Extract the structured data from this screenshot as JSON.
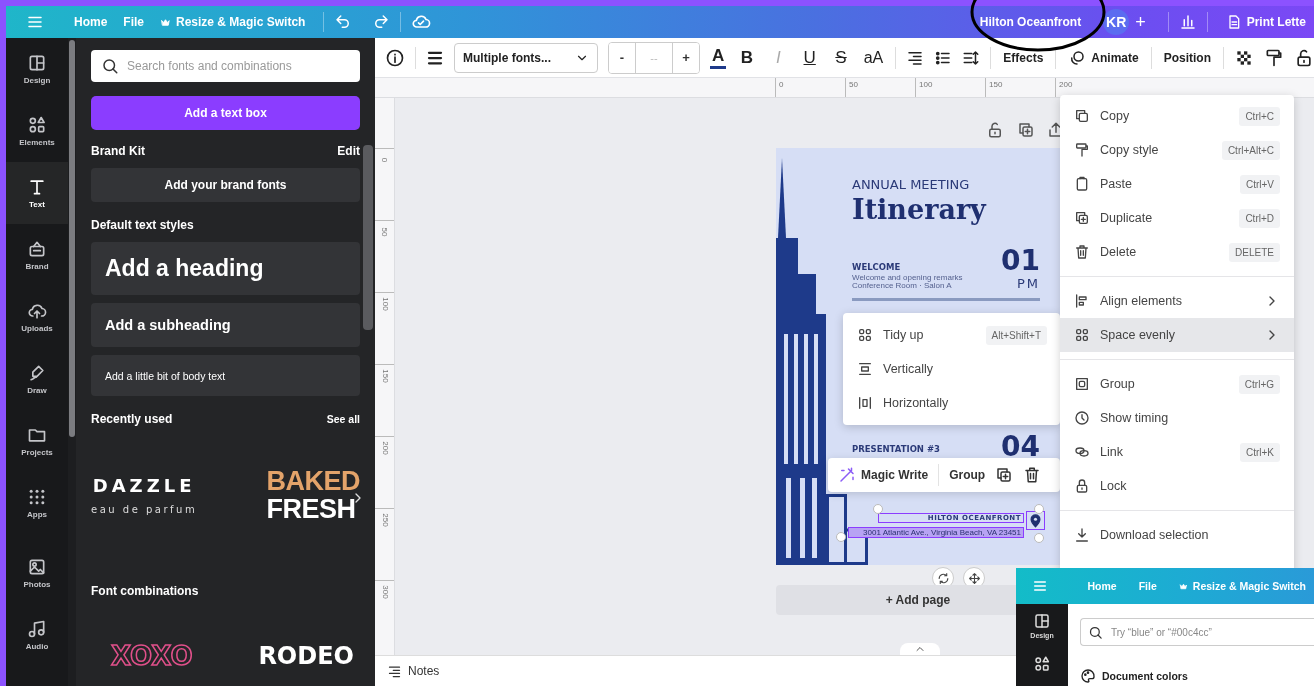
{
  "top_bar": {
    "nav": [
      {
        "label": "Home"
      },
      {
        "label": "File"
      }
    ],
    "resize": "Resize & Magic Switch",
    "title": "Hilton Oceanfront",
    "avatar": "KR",
    "add": "+",
    "print": "Print Lette"
  },
  "rail": [
    {
      "label": "Design",
      "selected": false
    },
    {
      "label": "Elements",
      "selected": false
    },
    {
      "label": "Text",
      "selected": true
    },
    {
      "label": "Brand",
      "selected": false
    },
    {
      "label": "Uploads",
      "selected": false
    },
    {
      "label": "Draw",
      "selected": false
    },
    {
      "label": "Projects",
      "selected": false
    },
    {
      "label": "Apps",
      "selected": false
    },
    {
      "label": "Photos",
      "selected": false
    },
    {
      "label": "Audio",
      "selected": false
    }
  ],
  "panel": {
    "search_placeholder": "Search fonts and combinations",
    "add_text_box": "Add a text box",
    "brand_kit": {
      "title": "Brand Kit",
      "edit": "Edit",
      "add_fonts": "Add your brand fonts"
    },
    "default_styles": {
      "title": "Default text styles",
      "heading": "Add a heading",
      "subheading": "Add a subheading",
      "body": "Add a little bit of body text"
    },
    "recently_used": {
      "title": "Recently used",
      "see_all": "See all",
      "fonts": [
        {
          "kind": "spaced",
          "lines": [
            "DAZZLE",
            "eau de parfum"
          ]
        },
        {
          "kind": "stacked",
          "lines": [
            "BAKED",
            "FRESH"
          ]
        }
      ]
    },
    "combinations": {
      "title": "Font combinations",
      "fonts": [
        {
          "kind": "outline",
          "label": "XOXO"
        },
        {
          "kind": "solid",
          "label": "RODEO"
        }
      ]
    }
  },
  "toolbar": {
    "font": "Multiple fonts...",
    "minus": "-",
    "size": "--",
    "plus": "+",
    "color_letter": "A",
    "styles": [
      {
        "label": "B",
        "kind": "bold"
      },
      {
        "label": "I",
        "kind": "italic"
      },
      {
        "label": "U",
        "kind": "underline"
      },
      {
        "label": "S",
        "kind": "strike"
      },
      {
        "label": "aA",
        "kind": "case"
      }
    ],
    "effects": "Effects",
    "animate": "Animate",
    "position": "Position"
  },
  "rulers": {
    "horizontal": [
      "0",
      "50",
      "100",
      "150",
      "200"
    ],
    "vertical": [
      "0",
      "50",
      "100",
      "150",
      "200",
      "250",
      "300"
    ]
  },
  "design": {
    "overline": "ANNUAL MEETING",
    "title": "Itinerary",
    "sessions": [
      {
        "title": "WELCOME",
        "details": [
          "Welcome and opening remarks",
          "Conference Room · Salon A"
        ],
        "number": "01",
        "time": "PM"
      },
      {
        "title": "PRESENTATION #3",
        "number": "04"
      }
    ],
    "venue": "HILTON OCEANFRONT",
    "address": "3001 Atlantic Ave., Virginia Beach, VA 23451"
  },
  "selection_toolbar": {
    "magic": "Magic Write",
    "group": "Group"
  },
  "space_menu": [
    {
      "label": "Tidy up",
      "shortcut": "Alt+Shift+T"
    },
    {
      "label": "Vertically"
    },
    {
      "label": "Horizontally"
    }
  ],
  "context_menu": [
    [
      {
        "label": "Copy",
        "shortcut": "Ctrl+C",
        "selected": false,
        "has_submenu": false
      },
      {
        "label": "Copy style",
        "shortcut": "Ctrl+Alt+C",
        "selected": false,
        "has_submenu": false
      },
      {
        "label": "Paste",
        "shortcut": "Ctrl+V",
        "selected": false,
        "has_submenu": false
      },
      {
        "label": "Duplicate",
        "shortcut": "Ctrl+D",
        "selected": false,
        "has_submenu": false
      },
      {
        "label": "Delete",
        "shortcut": "DELETE",
        "selected": false,
        "has_submenu": false
      }
    ],
    [
      {
        "label": "Align elements",
        "selected": false,
        "has_submenu": true
      },
      {
        "label": "Space evenly",
        "selected": true,
        "has_submenu": true
      }
    ],
    [
      {
        "label": "Group",
        "shortcut": "Ctrl+G",
        "selected": false,
        "has_submenu": false
      },
      {
        "label": "Show timing",
        "selected": false,
        "has_submenu": false
      },
      {
        "label": "Link",
        "shortcut": "Ctrl+K",
        "selected": false,
        "has_submenu": false
      },
      {
        "label": "Lock",
        "selected": false,
        "has_submenu": false
      }
    ],
    [
      {
        "label": "Download selection",
        "selected": false,
        "has_submenu": false
      }
    ]
  ],
  "add_page": "+ Add page",
  "notes": "Notes",
  "inset": {
    "nav": [
      {
        "label": "Home"
      },
      {
        "label": "File"
      }
    ],
    "resize": "Resize & Magic Switch",
    "rail": [
      {
        "label": "Design"
      }
    ],
    "search_placeholder": "Try “blue” or “#00c4cc”",
    "section": "Document colors"
  }
}
